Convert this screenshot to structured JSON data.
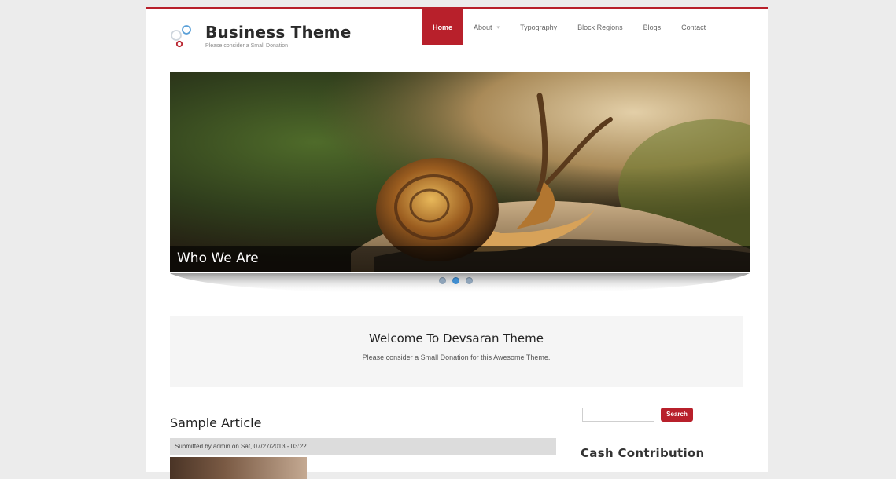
{
  "site": {
    "title": "Business Theme",
    "tagline": "Please consider a Small Donation",
    "accent_color": "#b8202b",
    "logo_icon": "bubbles-logo-icon"
  },
  "nav": {
    "items": [
      {
        "label": "Home",
        "active": true,
        "has_caret": false
      },
      {
        "label": "About",
        "active": false,
        "has_caret": true
      },
      {
        "label": "Typography",
        "active": false,
        "has_caret": false
      },
      {
        "label": "Block Regions",
        "active": false,
        "has_caret": false
      },
      {
        "label": "Blogs",
        "active": false,
        "has_caret": false
      },
      {
        "label": "Contact",
        "active": false,
        "has_caret": false
      }
    ]
  },
  "slider": {
    "caption": "Who We Are",
    "image_subject": "snail-on-rock-image",
    "slide_count": 3,
    "active_slide": 2
  },
  "welcome": {
    "title": "Welcome To Devsaran Theme",
    "subtitle": "Please consider a Small Donation for this Awesome Theme."
  },
  "article": {
    "title": "Sample Article",
    "meta": "Submitted by admin on Sat, 07/27/2013 - 03:22"
  },
  "sidebar": {
    "search_value": "",
    "search_button": "Search",
    "block_title": "Cash Contribution"
  }
}
